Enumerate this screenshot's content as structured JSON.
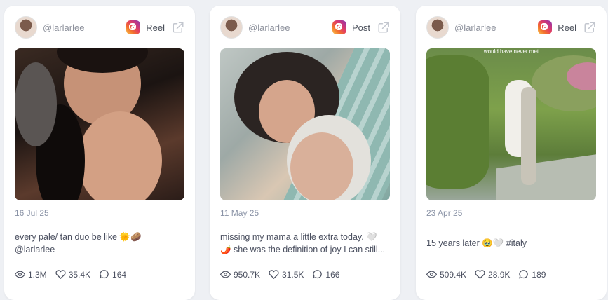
{
  "cards": [
    {
      "handle": "@larlarlee",
      "type": "Reel",
      "date": "16 Jul 25",
      "caption_lines": [
        "every pale/ tan duo be like 🌞🥔",
        "@larlarlee"
      ],
      "views": "1.3M",
      "likes": "35.4K",
      "comments": "164"
    },
    {
      "handle": "@larlarlee",
      "type": "Post",
      "date": "11 May 25",
      "caption_lines": [
        "missing my mama a little extra today. 🤍",
        "🌶️ she was the definition of joy I can still..."
      ],
      "views": "950.7K",
      "likes": "31.5K",
      "comments": "166"
    },
    {
      "handle": "@larlarlee",
      "type": "Reel",
      "date": "23 Apr 25",
      "media_overlay": "would have never met",
      "caption_lines": [
        "15 years later 🥹🤍 #italy"
      ],
      "views": "509.4K",
      "likes": "28.9K",
      "comments": "189"
    }
  ],
  "icons": {
    "platform": "instagram-icon",
    "external": "external-link-icon",
    "views": "eye-icon",
    "likes": "heart-icon",
    "comments": "comment-icon"
  }
}
